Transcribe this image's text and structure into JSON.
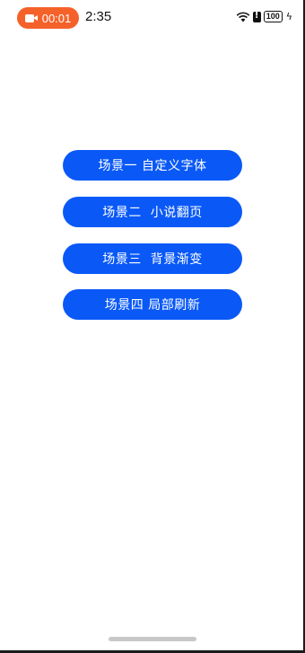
{
  "status_bar": {
    "recording_time": "00:01",
    "time": "2:35",
    "battery_level": "100",
    "icons": [
      "camera-icon",
      "wifi-icon",
      "alert-icon",
      "battery-icon",
      "charging-icon"
    ],
    "recording_color": "#f4622a"
  },
  "main": {
    "buttons": [
      {
        "label": "场景一 自定义字体"
      },
      {
        "label": "场景二  小说翻页"
      },
      {
        "label": "场景三  背景渐变"
      },
      {
        "label": "场景四 局部刷新"
      }
    ],
    "button_color": "#0a59f7"
  }
}
